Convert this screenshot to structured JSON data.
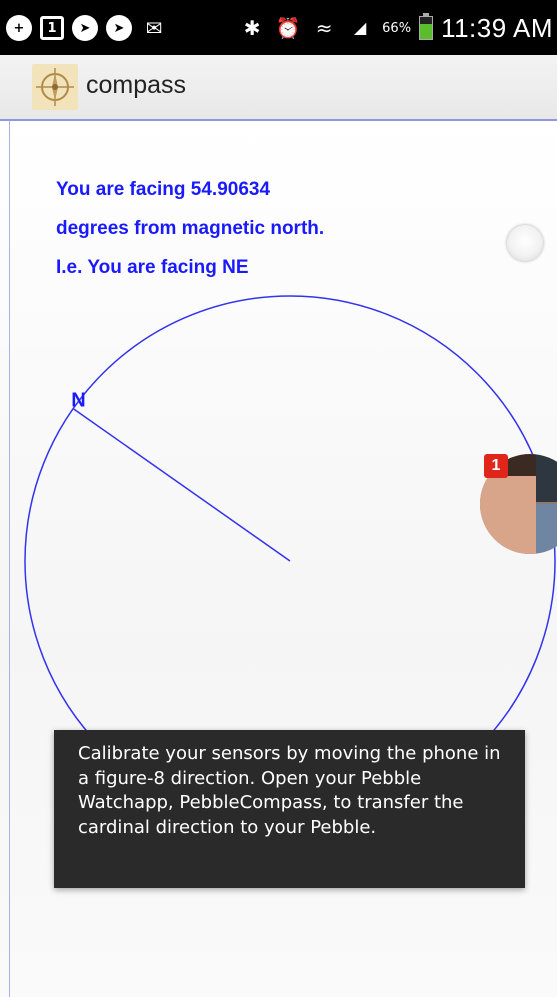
{
  "status_bar": {
    "left_icons": [
      "notification-plus-icon",
      "calendar-icon",
      "messenger-icon",
      "messenger-icon",
      "gmail-icon"
    ],
    "right_icons": [
      "bluetooth-icon",
      "alarm-icon",
      "wifi-icon",
      "signal-icon"
    ],
    "battery_percent": "66%",
    "battery_level": 0.66,
    "time": "11:39 AM"
  },
  "action_bar": {
    "app_icon": "compass-icon",
    "title": "compass"
  },
  "compass": {
    "line1": "You are facing 54.90634",
    "line2": "degrees from magnetic north.",
    "line3": "I.e. You are facing NE",
    "north_label": "N",
    "heading_degrees": 54.90634,
    "text_color": "#1a1aff",
    "line_color": "#3333ee"
  },
  "chat_head": {
    "badge_count": "1",
    "badge_color": "#e0251b"
  },
  "toast": {
    "message": "Calibrate your sensors by moving the phone in a figure-8 direction. Open your Pebble Watchapp, PebbleCompass, to transfer the cardinal direction to your Pebble."
  }
}
